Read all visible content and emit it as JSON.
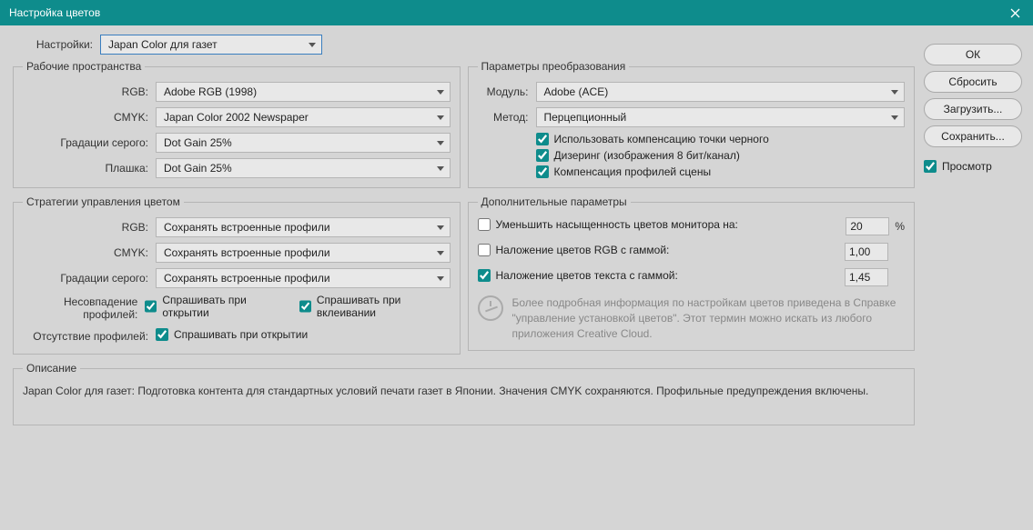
{
  "title": "Настройка цветов",
  "settings_label": "Настройки:",
  "settings_value": "Japan Color для газет",
  "workspaces": {
    "legend": "Рабочие пространства",
    "rgb_label": "RGB:",
    "rgb_value": "Adobe RGB (1998)",
    "cmyk_label": "CMYK:",
    "cmyk_value": "Japan Color 2002 Newspaper",
    "gray_label": "Градации серого:",
    "gray_value": "Dot Gain 25%",
    "spot_label": "Плашка:",
    "spot_value": "Dot Gain 25%"
  },
  "policies": {
    "legend": "Стратегии управления цветом",
    "rgb_label": "RGB:",
    "rgb_value": "Сохранять встроенные профили",
    "cmyk_label": "CMYK:",
    "cmyk_value": "Сохранять встроенные профили",
    "gray_label": "Градации серого:",
    "gray_value": "Сохранять встроенные профили",
    "mismatch_label": "Несовпадение профилей:",
    "mismatch_open": "Спрашивать при открытии",
    "mismatch_paste": "Спрашивать при вклеивании",
    "missing_label": "Отсутствие профилей:",
    "missing_open": "Спрашивать при открытии"
  },
  "conversion": {
    "legend": "Параметры преобразования",
    "engine_label": "Модуль:",
    "engine_value": "Adobe (ACE)",
    "intent_label": "Метод:",
    "intent_value": "Перцепционный",
    "bpc": "Использовать компенсацию точки черного",
    "dither": "Дизеринг (изображения 8 бит/канал)",
    "scene": "Компенсация профилей сцены"
  },
  "advanced": {
    "legend": "Дополнительные параметры",
    "desaturate": "Уменьшить насыщенность цветов монитора на:",
    "desaturate_value": "20",
    "blend_rgb": "Наложение цветов RGB с гаммой:",
    "blend_rgb_value": "1,00",
    "blend_text": "Наложение цветов текста с гаммой:",
    "blend_text_value": "1,45",
    "info": "Более подробная информация по настройкам цветов приведена в Справке \"управление установкой цветов\". Этот термин можно искать из любого приложения Creative Cloud."
  },
  "description": {
    "legend": "Описание",
    "text": "Japan Color для газет:  Подготовка контента для стандартных условий печати газет в Японии. Значения CMYK сохраняются. Профильные предупреждения включены."
  },
  "buttons": {
    "ok": "ОК",
    "cancel": "Сбросить",
    "load": "Загрузить...",
    "save": "Сохранить..."
  },
  "preview": "Просмотр",
  "pct": "%"
}
